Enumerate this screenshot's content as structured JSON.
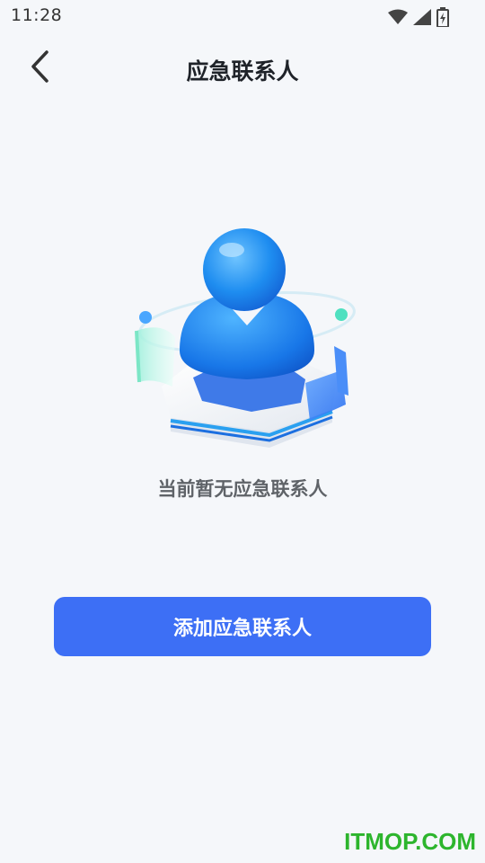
{
  "status_bar": {
    "time": "11:28",
    "icons": [
      "wifi-icon",
      "signal-icon",
      "battery-icon"
    ]
  },
  "header": {
    "back_icon": "chevron-left-icon",
    "title": "应急联系人"
  },
  "empty_state": {
    "illustration": "contact-person-3d-illustration",
    "message": "当前暂无应急联系人"
  },
  "actions": {
    "add_label": "添加应急联系人"
  },
  "watermark": "ITMOP.COM",
  "colors": {
    "background": "#f5f7fa",
    "primary": "#3d6ff5",
    "title": "#1f2329",
    "secondary_text": "#5f6368",
    "watermark": "#2db52d"
  }
}
